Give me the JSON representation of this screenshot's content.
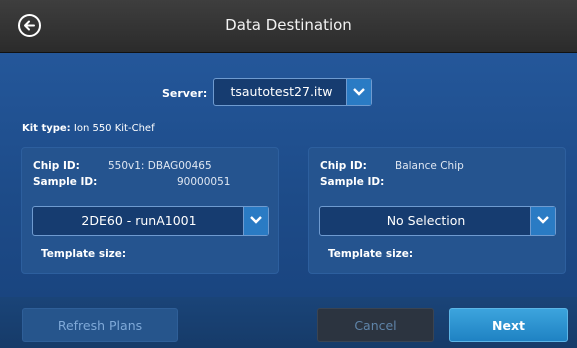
{
  "header": {
    "title": "Data Destination"
  },
  "server": {
    "label": "Server:",
    "value": "tsautotest27.itw"
  },
  "kit": {
    "label": "Kit type:",
    "value": "Ion 550 Kit-Chef"
  },
  "left_panel": {
    "chip_label": "Chip ID:",
    "chip_value": "550v1: DBAG00465",
    "sample_label": "Sample ID:",
    "sample_value": "90000051",
    "select_value": "2DE60 - runA1001",
    "template_label": "Template size:"
  },
  "right_panel": {
    "chip_label": "Chip ID:",
    "chip_value": "Balance Chip",
    "sample_label": "Sample ID:",
    "sample_value": "",
    "select_value": "No Selection",
    "template_label": "Template size:"
  },
  "footer": {
    "refresh_label": "Refresh Plans",
    "cancel_label": "Cancel",
    "next_label": "Next"
  },
  "colors": {
    "accent": "#2a7bc4",
    "background": "#1c4a86",
    "next": "#2d95d2"
  }
}
